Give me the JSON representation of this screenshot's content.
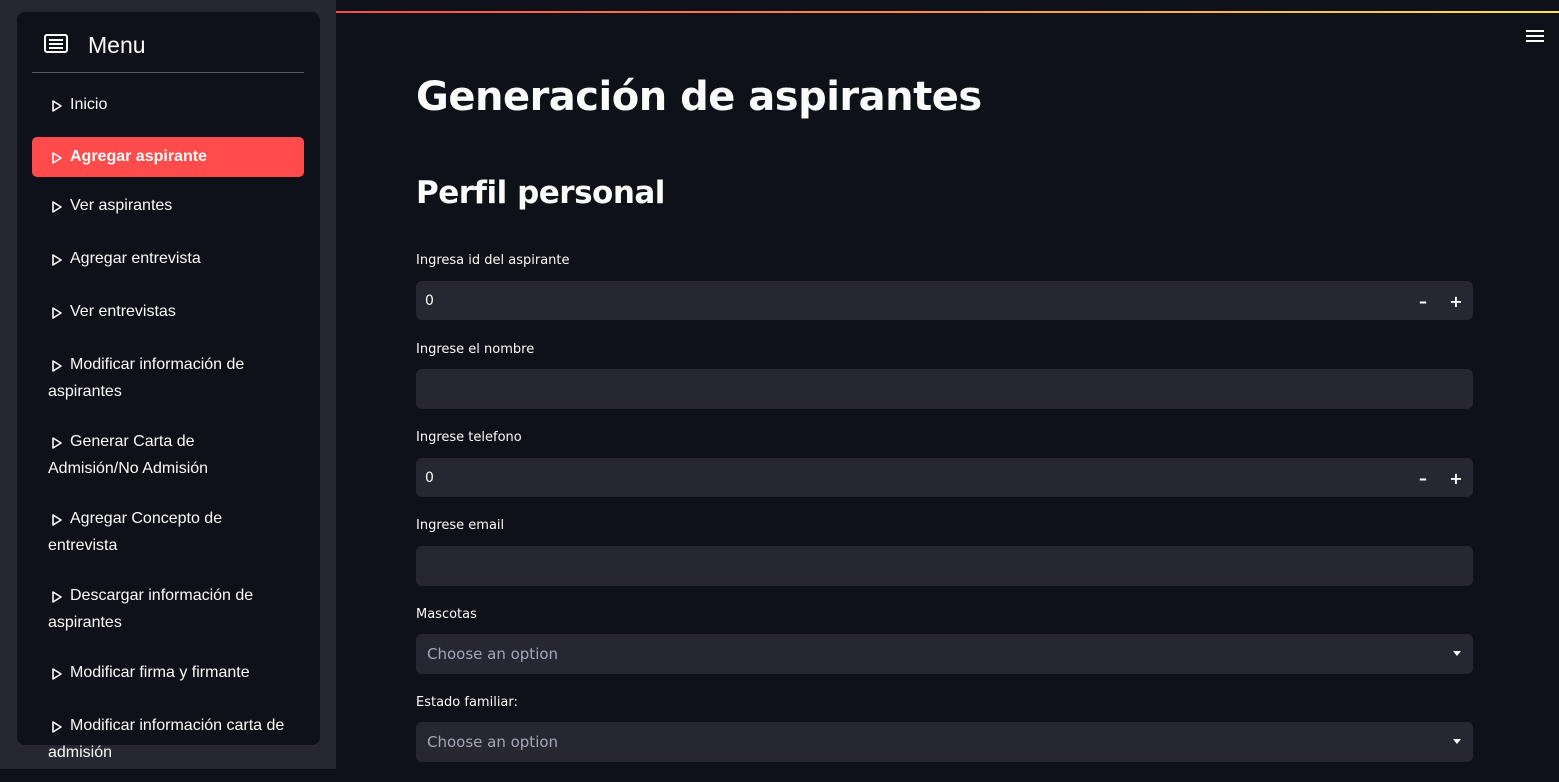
{
  "sidebar": {
    "title": "Menu",
    "items": [
      {
        "label": "Inicio"
      },
      {
        "label": "Agregar aspirante",
        "active": true
      },
      {
        "label": "Ver aspirantes"
      },
      {
        "label": "Agregar entrevista"
      },
      {
        "label": "Ver entrevistas"
      },
      {
        "label": "Modificar información de aspirantes"
      },
      {
        "label": "Generar Carta de Admisión/No Admisión"
      },
      {
        "label": "Agregar Concepto de entrevista"
      },
      {
        "label": "Descargar información de aspirantes"
      },
      {
        "label": "Modificar firma y firmante"
      },
      {
        "label": "Modificar información carta de admisión"
      }
    ]
  },
  "main": {
    "title": "Generación de aspirantes",
    "section_title": "Perfil personal",
    "fields": {
      "id": {
        "label": "Ingresa id del aspirante",
        "value": "0",
        "minus": "–",
        "plus": "+"
      },
      "nombre": {
        "label": "Ingrese el nombre",
        "value": ""
      },
      "telefono": {
        "label": "Ingrese telefono",
        "value": "0",
        "minus": "–",
        "plus": "+"
      },
      "email": {
        "label": "Ingrese email",
        "value": ""
      },
      "mascotas": {
        "label": "Mascotas",
        "placeholder": "Choose an option"
      },
      "estado": {
        "label": "Estado familiar:",
        "placeholder": "Choose an option"
      }
    }
  },
  "colors": {
    "accent": "#ff4b4b",
    "background": "#0e1117",
    "sidebar": "#262730",
    "input": "#262730"
  },
  "icons": {
    "menu": "menu-list-icon",
    "nav": "caret-right-outline-icon",
    "app_menu": "hamburger-icon"
  }
}
